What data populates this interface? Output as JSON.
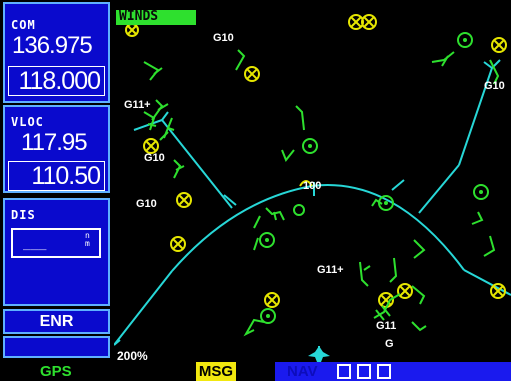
{
  "left_panel": {
    "com": {
      "label": "COM",
      "standby": "136.975",
      "active": "118.000"
    },
    "vloc": {
      "label": "VLOC",
      "standby": "117.95",
      "active": "110.50"
    },
    "dis": {
      "label": "DIS",
      "value": "___",
      "unit": "nm"
    },
    "mode": {
      "label": "ENR"
    }
  },
  "map": {
    "winds_label": "WINDS",
    "range_ring_label": "100",
    "zoom_label": "200%",
    "airport_labels": [
      {
        "text": "G10"
      },
      {
        "text": "G11+"
      },
      {
        "text": "G10"
      },
      {
        "text": "G10"
      },
      {
        "text": "G10"
      },
      {
        "text": "G11+"
      },
      {
        "text": "G11"
      },
      {
        "text": "G"
      }
    ],
    "colors": {
      "accent_green": "#2ee02e",
      "ring_cyan": "#27d7d7",
      "symbol_yellow": "#e6e600"
    }
  },
  "status_bar": {
    "gps": "GPS",
    "msg": "MSG",
    "nav": "NAV"
  },
  "icons": [
    "aircraft-icon",
    "airport-icon",
    "vor-icon",
    "wind-barb-icon"
  ]
}
